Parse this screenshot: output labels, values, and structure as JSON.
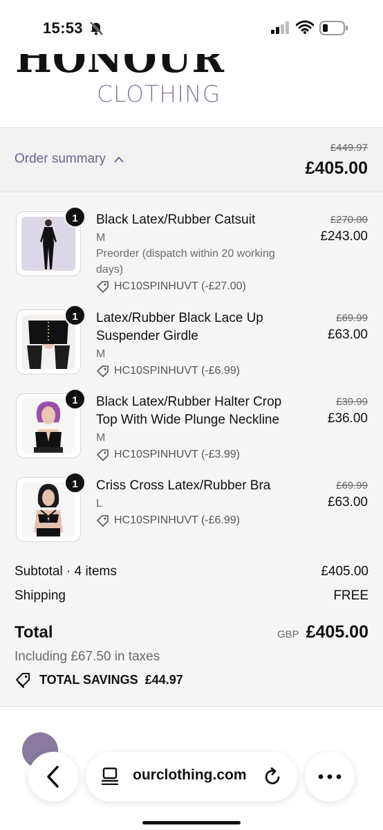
{
  "status_bar": {
    "time": "15:53",
    "icons": [
      "bell-slash-icon",
      "signal-icon",
      "wifi-icon",
      "battery-icon"
    ]
  },
  "logo": {
    "top_text": "HONOUR",
    "bottom_text": "CLOTHING",
    "accent_color": "#8a7aa0"
  },
  "order_summary": {
    "label": "Order summary",
    "compare_total": "£449.97",
    "total": "£405.00"
  },
  "products": [
    {
      "quantity": "1",
      "title": "Black Latex/Rubber Catsuit",
      "variant": "M",
      "note": "Preorder (dispatch within 20 working days)",
      "discount": "HC10SPINHUVT (-£27.00)",
      "compare_price": "£270.00",
      "price": "£243.00"
    },
    {
      "quantity": "1",
      "title": "Latex/Rubber Black Lace Up Suspender Girdle",
      "variant": "M",
      "note": "",
      "discount": "HC10SPINHUVT (-£6.99)",
      "compare_price": "£69.99",
      "price": "£63.00"
    },
    {
      "quantity": "1",
      "title": "Black Latex/Rubber Halter Crop Top With Wide Plunge Neckline",
      "variant": "M",
      "note": "",
      "discount": "HC10SPINHUVT (-£3.99)",
      "compare_price": "£39.99",
      "price": "£36.00"
    },
    {
      "quantity": "1",
      "title": "Criss Cross Latex/Rubber Bra",
      "variant": "L",
      "note": "",
      "discount": "HC10SPINHUVT (-£6.99)",
      "compare_price": "£69.99",
      "price": "£63.00"
    }
  ],
  "totals": {
    "subtotal_label": "Subtotal · 4 items",
    "subtotal_value": "£405.00",
    "shipping_label": "Shipping",
    "shipping_value": "FREE",
    "total_label": "Total",
    "currency": "GBP",
    "total_value": "£405.00",
    "taxes_note": "Including £67.50 in taxes",
    "savings_label": "TOTAL SAVINGS",
    "savings_value": "£44.97"
  },
  "browser": {
    "url": "ourclothing.com",
    "icons": [
      "back-icon",
      "reader-icon",
      "reload-icon",
      "more-icon"
    ]
  }
}
